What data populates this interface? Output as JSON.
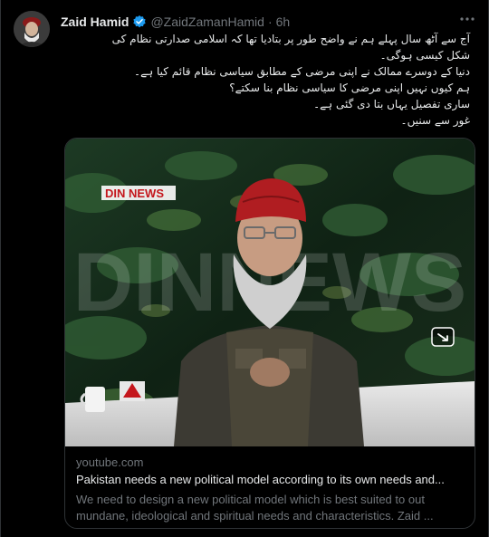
{
  "tweet": {
    "display_name": "Zaid Hamid",
    "handle": "@ZaidZamanHamid",
    "separator": "·",
    "time": "6h",
    "lines": [
      "آج سے آٹھ سال پہلے ہم نے واضح طور پر بتادیا تھا کہ اسلامی صدارتی نظام کی",
      "شکل کیسی ہوگی۔",
      "دنیا کے دوسرے ممالک نے اپنی مرضی کے مطابق سیاسی نظام قائم کیا ہے۔",
      "ہم کیوں نہیں اپنی مرضی کا سیاسی نظام بنا سکتے؟",
      "ساری تفصیل یہاں بتا دی گئی ہے۔",
      "غور سے سنیں۔"
    ]
  },
  "card": {
    "domain": "youtube.com",
    "title": "Pakistan needs a new political model according to its own needs and...",
    "description_lines": [
      "We need to design a new political model which is best suited to out",
      "mundane, ideological and spiritual needs and characteristics. Zaid ..."
    ],
    "thumbnail": {
      "logo_text": "DIN NEWS",
      "watermark_text": "DINNEWS"
    }
  },
  "colors": {
    "background": "#000000",
    "primary_text": "#e7e9ea",
    "secondary_text": "#71767b",
    "border": "#2f3336",
    "verified": "#1d9bf0"
  },
  "icons": {
    "verified": "verified-badge-icon",
    "more": "more-options-icon",
    "expand": "expand-icon"
  }
}
